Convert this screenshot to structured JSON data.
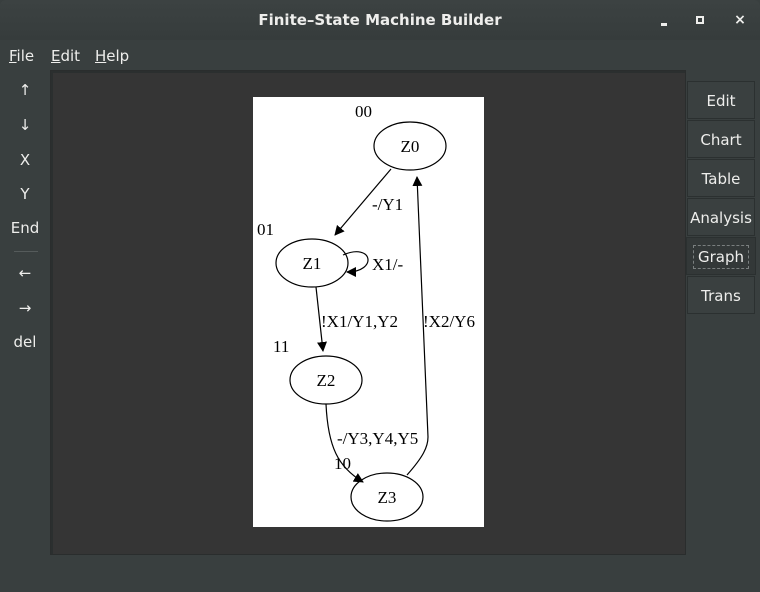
{
  "window": {
    "title": "Finite–State Machine Builder",
    "controls": {
      "minimize": "minimize",
      "maximize": "maximize",
      "close": "×"
    }
  },
  "menubar": [
    {
      "mnemonic": "F",
      "rest": "ile"
    },
    {
      "mnemonic": "E",
      "rest": "dit"
    },
    {
      "mnemonic": "H",
      "rest": "elp"
    }
  ],
  "left_toolbar": [
    {
      "label": "↑",
      "icon": "arrow-up-icon"
    },
    {
      "label": "↓",
      "icon": "arrow-down-icon"
    },
    {
      "label": "X"
    },
    {
      "label": "Y"
    },
    {
      "label": "End"
    },
    {
      "label": "←",
      "icon": "arrow-left-icon"
    },
    {
      "label": "→",
      "icon": "arrow-right-icon"
    },
    {
      "label": "del"
    }
  ],
  "right_tabs": [
    {
      "label": "Edit",
      "active": false
    },
    {
      "label": "Chart",
      "active": false
    },
    {
      "label": "Table",
      "active": false
    },
    {
      "label": "Analysis",
      "active": false
    },
    {
      "label": "Graph",
      "active": true
    },
    {
      "label": "Trans",
      "active": false
    }
  ],
  "graph": {
    "states": [
      {
        "name": "Z0",
        "code": "00"
      },
      {
        "name": "Z1",
        "code": "01"
      },
      {
        "name": "Z2",
        "code": "11"
      },
      {
        "name": "Z3",
        "code": "10"
      }
    ],
    "transitions": [
      {
        "from": "Z0",
        "to": "Z1",
        "label": "-/Y1"
      },
      {
        "from": "Z1",
        "to": "Z1",
        "label": "X1/-"
      },
      {
        "from": "Z1",
        "to": "Z2",
        "label": "!X1/Y1,Y2"
      },
      {
        "from": "Z2",
        "to": "Z3",
        "label": "-/Y3,Y4,Y5"
      },
      {
        "from": "Z3",
        "to": "Z0",
        "label": "!X2/Y6"
      }
    ]
  }
}
